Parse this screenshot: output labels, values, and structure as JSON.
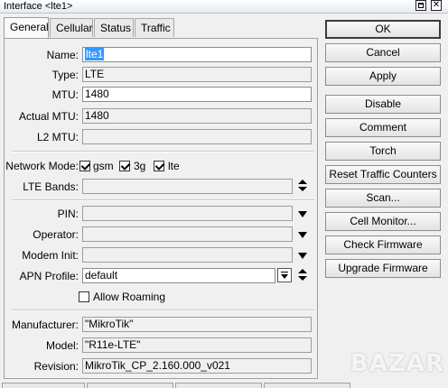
{
  "window": {
    "title": "Interface <lte1>"
  },
  "tabs": [
    {
      "label": "General",
      "active": true
    },
    {
      "label": "Cellular",
      "active": false
    },
    {
      "label": "Status",
      "active": false
    },
    {
      "label": "Traffic",
      "active": false
    }
  ],
  "general": {
    "name": {
      "label": "Name:",
      "value": "lte1"
    },
    "type": {
      "label": "Type:",
      "value": "LTE"
    },
    "mtu": {
      "label": "MTU:",
      "value": "1480"
    },
    "actual_mtu": {
      "label": "Actual MTU:",
      "value": "1480"
    },
    "l2_mtu": {
      "label": "L2 MTU:",
      "value": ""
    },
    "network_mode": {
      "label": "Network Mode:",
      "options": [
        {
          "label": "gsm",
          "checked": true
        },
        {
          "label": "3g",
          "checked": true
        },
        {
          "label": "lte",
          "checked": true
        }
      ]
    },
    "lte_bands": {
      "label": "LTE Bands:",
      "value": ""
    },
    "pin": {
      "label": "PIN:",
      "value": ""
    },
    "operator": {
      "label": "Operator:",
      "value": ""
    },
    "modem_init": {
      "label": "Modem Init:",
      "value": ""
    },
    "apn_profile": {
      "label": "APN Profile:",
      "value": "default"
    },
    "allow_roaming": {
      "label": "Allow Roaming",
      "checked": false
    },
    "manufacturer": {
      "label": "Manufacturer:",
      "value": "\"MikroTik\""
    },
    "model": {
      "label": "Model:",
      "value": "\"R11e-LTE\""
    },
    "revision": {
      "label": "Revision:",
      "value": "MikroTik_CP_2.160.000_v021"
    }
  },
  "buttons": {
    "ok": "OK",
    "cancel": "Cancel",
    "apply": "Apply",
    "disable": "Disable",
    "comment": "Comment",
    "torch": "Torch",
    "reset_traffic_counters": "Reset Traffic Counters",
    "scan": "Scan...",
    "cell_monitor": "Cell Monitor...",
    "check_firmware": "Check Firmware",
    "upgrade_firmware": "Upgrade Firmware"
  },
  "watermark": {
    "text": "BAZAR"
  }
}
